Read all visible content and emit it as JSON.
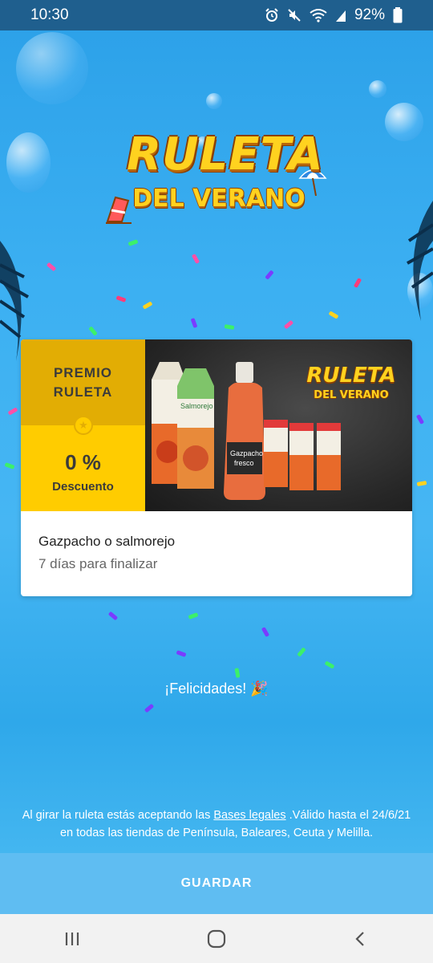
{
  "status_bar": {
    "time": "10:30",
    "battery": "92%",
    "icons": [
      "alarm-icon",
      "mute-icon",
      "wifi-icon",
      "signal-icon",
      "battery-icon"
    ]
  },
  "logo": {
    "line1": "RULETA",
    "line2": "DEL VERANO"
  },
  "card": {
    "prize_title": "PREMIO RULETA",
    "prize_value": "0 %",
    "prize_label": "Descuento",
    "banner_logo_line1": "RULETA",
    "banner_logo_line2": "DEL VERANO",
    "title": "Gazpacho o salmorejo",
    "subtitle": "7 días para finalizar"
  },
  "felicidades": "¡Felicidades! 🎉",
  "legal": {
    "before": "Al girar la ruleta estás aceptando las ",
    "link": "Bases legales",
    "after": " .Válido hasta el 24/6/21 en todas las tiendas de Península, Baleares, Ceuta y Melilla."
  },
  "save_button": "GUARDAR",
  "colors": {
    "prize_dark": "#e2ad04",
    "prize_light": "#ffcc00",
    "button": "#5fbdf2"
  }
}
